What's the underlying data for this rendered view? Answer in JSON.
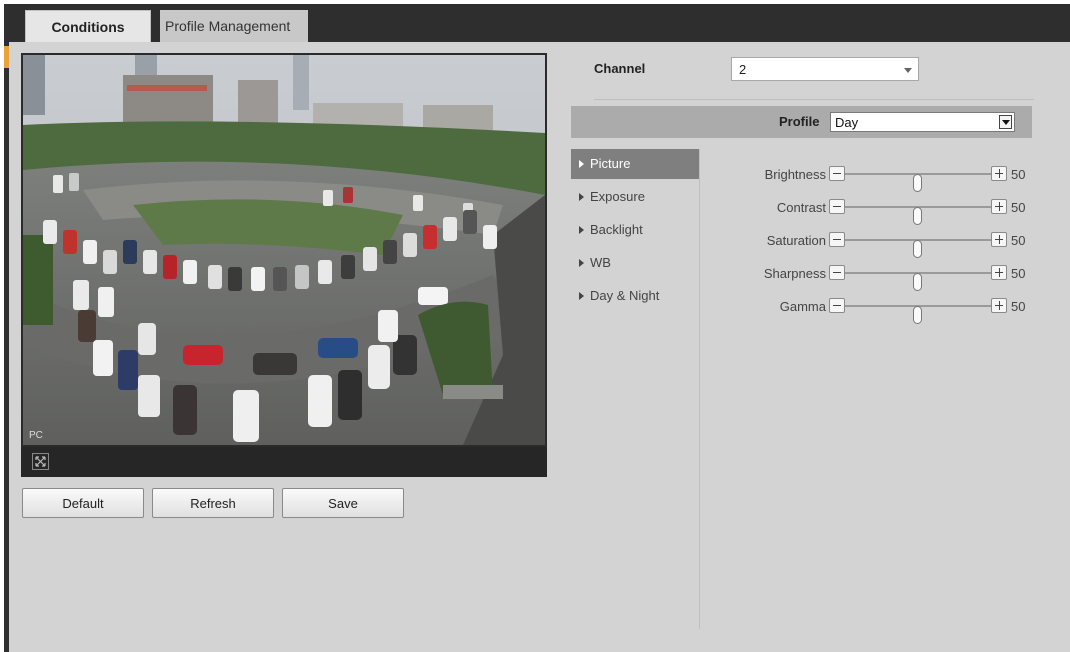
{
  "tabs": [
    {
      "label": "Conditions",
      "active": true
    },
    {
      "label": "Profile Management",
      "active": false
    }
  ],
  "preview": {
    "overlay_timestamp": "",
    "osd_label": "PC"
  },
  "buttons": {
    "default_label": "Default",
    "refresh_label": "Refresh",
    "save_label": "Save"
  },
  "channel": {
    "label": "Channel",
    "value": "2"
  },
  "profile": {
    "label": "Profile",
    "value": "Day"
  },
  "menu": [
    {
      "label": "Picture",
      "active": true
    },
    {
      "label": "Exposure",
      "active": false
    },
    {
      "label": "Backlight",
      "active": false
    },
    {
      "label": "WB",
      "active": false
    },
    {
      "label": "Day & Night",
      "active": false
    }
  ],
  "sliders": [
    {
      "label": "Brightness",
      "value": "50",
      "fraction": 0.5
    },
    {
      "label": "Contrast",
      "value": "50",
      "fraction": 0.5
    },
    {
      "label": "Saturation",
      "value": "50",
      "fraction": 0.5
    },
    {
      "label": "Sharpness",
      "value": "50",
      "fraction": 0.5
    },
    {
      "label": "Gamma",
      "value": "50",
      "fraction": 0.5
    }
  ],
  "colors": {
    "topbar": "#2e2e2e",
    "panel": "#d3d3d3",
    "active_menu": "#7f7f7f",
    "profile_bar": "#ababab",
    "accent": "#e8a33d"
  },
  "icons": [
    "fullscreen-icon",
    "minus-icon",
    "plus-icon",
    "dropdown-arrow-icon",
    "menu-arrow-icon"
  ]
}
